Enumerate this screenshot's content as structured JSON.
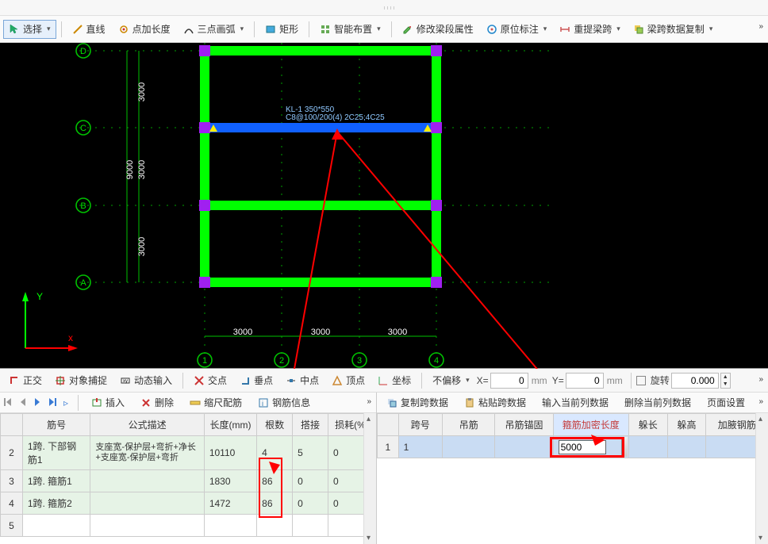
{
  "toolbar1": {
    "select": "选择",
    "line": "直线",
    "point_add": "点加长度",
    "arc3": "三点画弧",
    "rect": "矩形",
    "smart_place": "智能布置",
    "modify_beam_prop": "修改梁段属性",
    "origin_marker": "原位标注",
    "reset_beam_span": "重提梁跨",
    "copy_span_data": "梁跨数据复制"
  },
  "beam_label": {
    "name": "KL-1 350*550",
    "rebar": "C8@100/200(4) 2C25;4C25"
  },
  "dims": {
    "v": [
      "3000",
      "3000",
      "3000"
    ],
    "v_total": "9000",
    "h": [
      "3000",
      "3000",
      "3000"
    ]
  },
  "axis_y": "Y",
  "axis_x": "x",
  "toolbar2": {
    "ortho": "正交",
    "osnap": "对象捕捉",
    "dyn_input": "动态输入",
    "intersection": "交点",
    "perpendicular": "垂点",
    "midpoint": "中点",
    "vertex": "顶点",
    "coord": "坐标",
    "no_offset": "不偏移",
    "x_label": "X=",
    "x_value": "0",
    "y_label": "Y=",
    "y_value": "0",
    "unit": "mm",
    "rotate": "旋转",
    "rotate_value": "0.000"
  },
  "left_mini_tb": {
    "insert": "插入",
    "delete": "删除",
    "scale_rebar": "缩尺配筋",
    "rebar_info": "钢筋信息"
  },
  "left_table": {
    "cols": [
      "筋号",
      "公式描述",
      "长度(mm)",
      "根数",
      "搭接",
      "损耗(%)"
    ],
    "rows": [
      {
        "n": "2",
        "c1": "1跨. 下部钢筋1",
        "c2": "支座宽-保护层+弯折+净长+支座宽-保护层+弯折",
        "c3": "10110",
        "c4": "4",
        "c5": "5",
        "c6": "0"
      },
      {
        "n": "3",
        "c1": "1跨. 箍筋1",
        "c2": "",
        "c3": "1830",
        "c4": "86",
        "c5": "0",
        "c6": "0"
      },
      {
        "n": "4",
        "c1": "1跨. 箍筋2",
        "c2": "",
        "c3": "1472",
        "c4": "86",
        "c5": "0",
        "c6": "0"
      },
      {
        "n": "5",
        "c1": "",
        "c2": "",
        "c3": "",
        "c4": "",
        "c5": "",
        "c6": ""
      }
    ]
  },
  "right_mini_tb": {
    "copy_span": "复制跨数据",
    "paste_span": "粘贴跨数据",
    "input_cur_col": "输入当前列数据",
    "delete_cur_col": "删除当前列数据",
    "page_setup": "页面设置"
  },
  "right_table": {
    "cols": [
      "跨号",
      "吊筋",
      "吊筋锚固",
      "箍筋加密长度",
      "躲长",
      "躲高",
      "加腋钢筋"
    ],
    "row": {
      "n": "1",
      "span": "1",
      "edit_value": "5000"
    }
  }
}
